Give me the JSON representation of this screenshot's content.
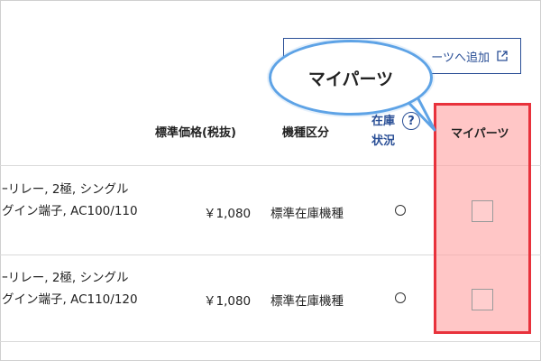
{
  "add_button": {
    "label": "ーツへ追加"
  },
  "bubble": {
    "label": "マイパーツ"
  },
  "headers": {
    "price": "標準価格(税抜)",
    "model_class": "機種区分",
    "stock_line1": "在庫",
    "stock_line2": "状況",
    "help": "?",
    "my_parts": "マイパーツ"
  },
  "rows": [
    {
      "desc_line1": "ｰリレー, 2極, シングル",
      "desc_line2": "グイン端子, AC100/110",
      "price": "￥1,080",
      "model_class": "標準在庫機種",
      "stock": "○"
    },
    {
      "desc_line1": "ｰリレー, 2極, シングル",
      "desc_line2": "グイン端子, AC110/120",
      "price": "￥1,080",
      "model_class": "標準在庫機種",
      "stock": "○"
    }
  ],
  "colors": {
    "accent": "#2a4f96",
    "highlight_border": "#e8323c",
    "highlight_fill": "#ffa0a0",
    "bubble_border": "#5ea3e6"
  }
}
